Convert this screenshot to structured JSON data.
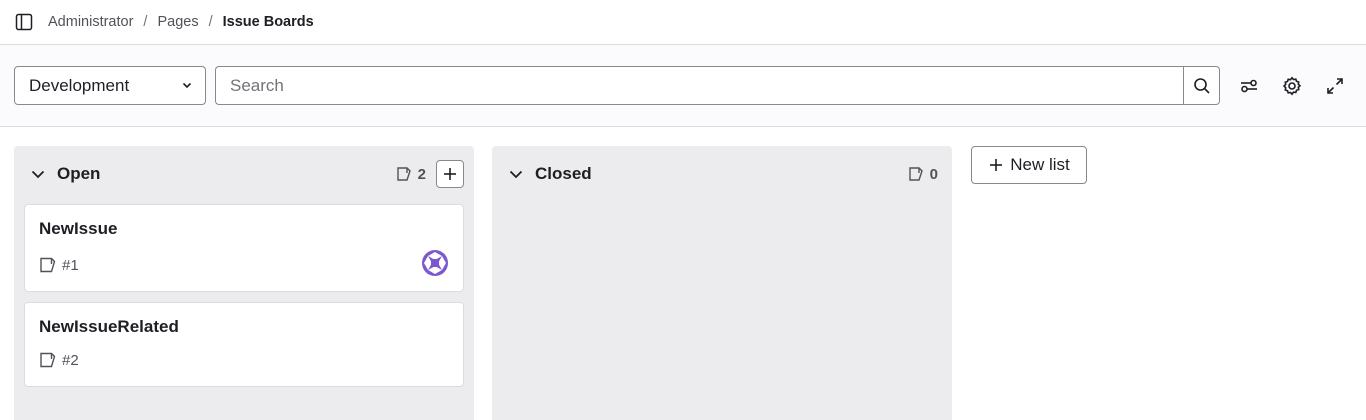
{
  "breadcrumb": {
    "items": [
      "Administrator",
      "Pages"
    ],
    "separator": "/",
    "current": "Issue Boards"
  },
  "filter": {
    "board_select": "Development",
    "search_placeholder": "Search"
  },
  "lists": [
    {
      "title": "Open",
      "count": "2",
      "cards": [
        {
          "title": "NewIssue",
          "ref": "#1",
          "has_avatar": true
        },
        {
          "title": "NewIssueRelated",
          "ref": "#2",
          "has_avatar": false
        }
      ]
    },
    {
      "title": "Closed",
      "count": "0",
      "cards": []
    }
  ],
  "new_list_label": "New list",
  "icons": {
    "sidebar": "sidebar-toggle-icon",
    "search": "search-icon",
    "filter": "filter-settings-icon",
    "settings": "gear-icon",
    "fullscreen": "expand-icon",
    "issue": "issue-icon",
    "avatar_color": "#7b58cf"
  }
}
